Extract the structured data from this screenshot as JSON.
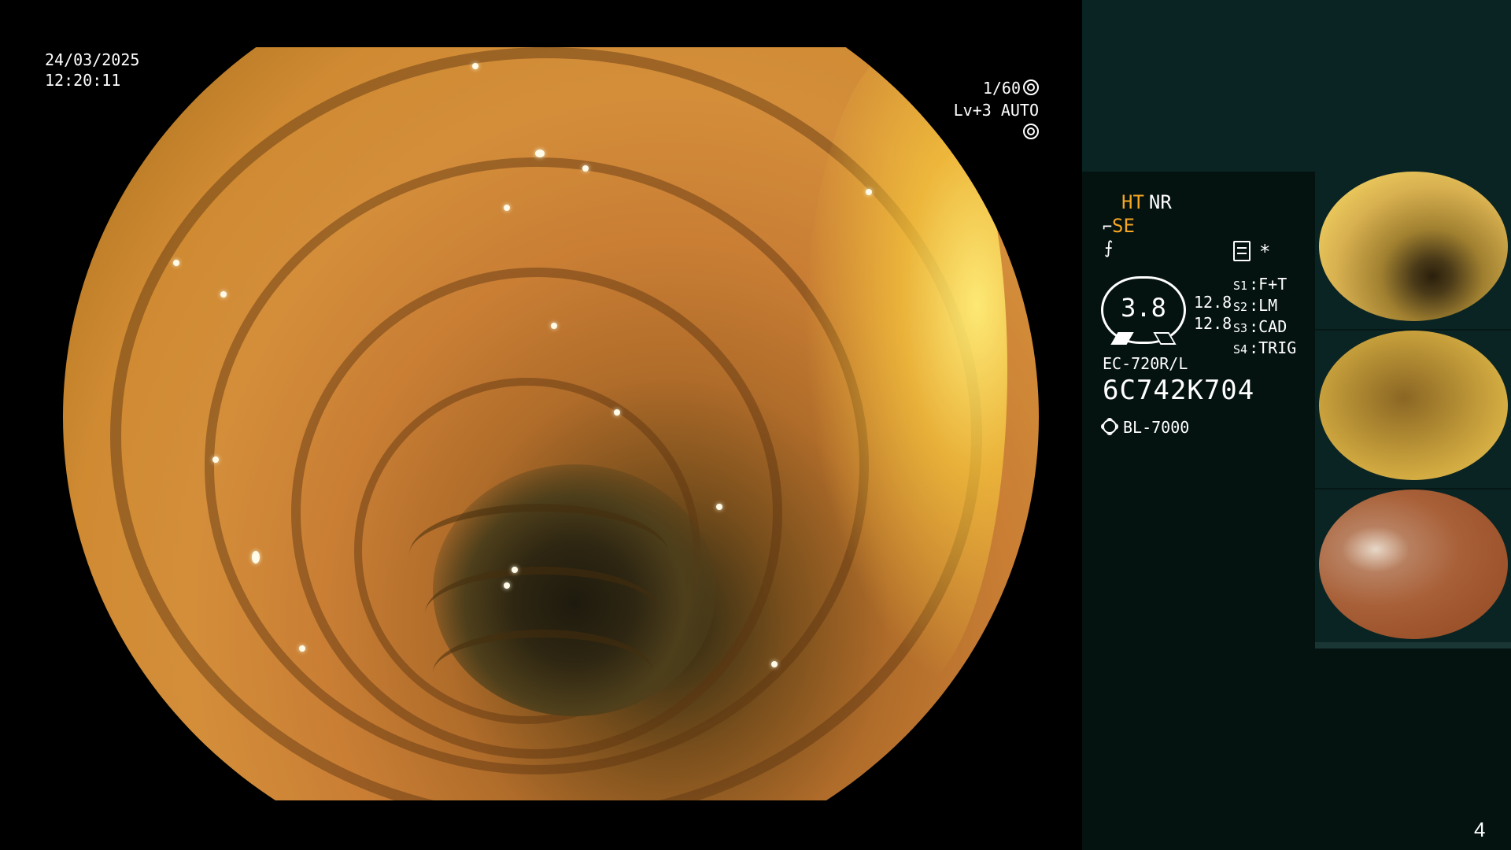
{
  "main_view": {
    "date": "24/03/2025",
    "time": "12:20:11",
    "shutter": "1/60",
    "exposure": "Lv+3 AUTO",
    "shutter_icon": "aperture-icon",
    "exposure_icon": "auto-exposure-icon"
  },
  "panel": {
    "ht": "HT",
    "nr": "NR",
    "se": "SE",
    "se_icon": "scope-icon",
    "tool_icon": "clip-icon",
    "memory_icon": "memory-card-icon",
    "star": "*",
    "gauge_value": "3.8",
    "num1": "12.8",
    "num2": "12.8",
    "slots": [
      {
        "key": "S1",
        "value": "F+T"
      },
      {
        "key": "S2",
        "value": "LM"
      },
      {
        "key": "S3",
        "value": "CAD"
      },
      {
        "key": "S4",
        "value": "TRIG"
      }
    ],
    "model": "EC-720R/L",
    "serial": "6C742K704",
    "light_source": "BL-7000",
    "light_icon": "sun-icon"
  },
  "thumbnails": [
    {
      "label": "thumbnail-1"
    },
    {
      "label": "thumbnail-2"
    },
    {
      "label": "thumbnail-3"
    }
  ],
  "page_number": "4",
  "colors": {
    "accent": "#f5a623",
    "panel_bg": "#041210",
    "panel_header": "#0a2424"
  }
}
